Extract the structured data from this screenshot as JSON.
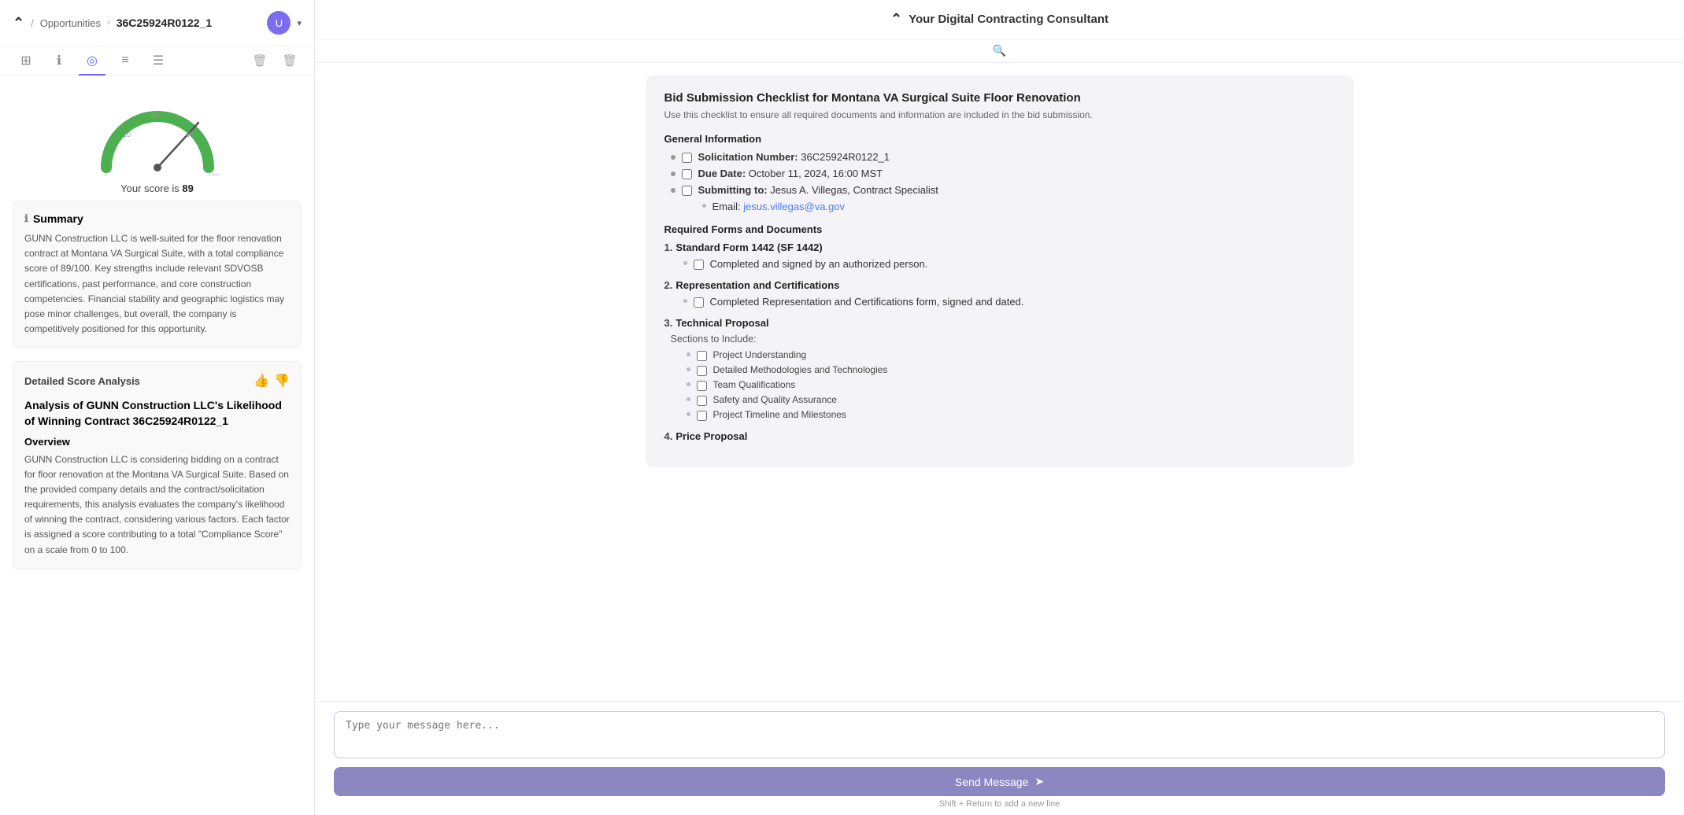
{
  "header": {
    "logo": "⌃",
    "breadcrumb": "Opportunities",
    "breadcrumb_arrow": ">",
    "page_id": "36C25924R0122_1",
    "user_avatar": "U",
    "app_title": "Your Digital Contracting Consultant"
  },
  "tabs": [
    {
      "id": "layers",
      "icon": "⊞",
      "active": false
    },
    {
      "id": "info",
      "icon": "ℹ",
      "active": false
    },
    {
      "id": "chart",
      "icon": "◎",
      "active": true
    },
    {
      "id": "stack",
      "icon": "≡",
      "active": false
    },
    {
      "id": "doc",
      "icon": "📄",
      "active": false
    }
  ],
  "gauge": {
    "score": 89,
    "max": 100,
    "label_prefix": "Your score is ",
    "label_bold": "89"
  },
  "summary": {
    "title": "Summary",
    "text": "GUNN Construction LLC is well-suited for the floor renovation contract at Montana VA Surgical Suite, with a total compliance score of 89/100. Key strengths include relevant SDVOSB certifications, past performance, and core construction competencies. Financial stability and geographic logistics may pose minor challenges, but overall, the company is competitively positioned for this opportunity."
  },
  "detailed_score": {
    "title": "Detailed Score Analysis",
    "analysis_title": "Analysis of GUNN Construction LLC's Likelihood of Winning Contract 36C25924R0122_1",
    "overview_label": "Overview",
    "overview_text": "GUNN Construction LLC is considering bidding on a contract for floor renovation at the Montana VA Surgical Suite. Based on the provided company details and the contract/solicitation requirements, this analysis evaluates the company's likelihood of winning the contract, considering various factors. Each factor is assigned a score contributing to a total \"Compliance Score\" on a scale from 0 to 100."
  },
  "checklist": {
    "title": "Bid Submission Checklist for Montana VA Surgical Suite Floor Renovation",
    "subtitle": "Use this checklist to ensure all required documents and information are included in the bid submission.",
    "sections": {
      "general_info": {
        "heading": "General Information",
        "items": [
          {
            "label": "Solicitation Number:",
            "value": " 36C25924R0122_1"
          },
          {
            "label": "Due Date:",
            "value": " October 11, 2024, 16:00 MST"
          },
          {
            "label": "Submitting to:",
            "value": " Jesus A. Villegas, Contract Specialist"
          },
          {
            "sub": true,
            "label": "Email:",
            "value": "jesus.villegas@va.gov"
          }
        ]
      },
      "required_forms": {
        "heading": "Required Forms and Documents",
        "numbered": [
          {
            "num": "1.",
            "title": "Standard Form 1442 (SF 1442)",
            "items": [
              "Completed and signed by an authorized person."
            ]
          },
          {
            "num": "2.",
            "title": "Representation and Certifications",
            "items": [
              "Completed Representation and Certifications form, signed and dated."
            ]
          },
          {
            "num": "3.",
            "title": "Technical Proposal",
            "sections_label": "Sections to Include:",
            "sub_items": [
              "Project Understanding",
              "Detailed Methodologies and Technologies",
              "Team Qualifications",
              "Safety and Quality Assurance",
              "Project Timeline and Milestones"
            ]
          },
          {
            "num": "4.",
            "title": "Price Proposal",
            "items": []
          }
        ]
      }
    }
  },
  "input": {
    "placeholder": "Type your message here...",
    "send_label": "Send Message",
    "hint": "Shift + Return to add a new line"
  }
}
